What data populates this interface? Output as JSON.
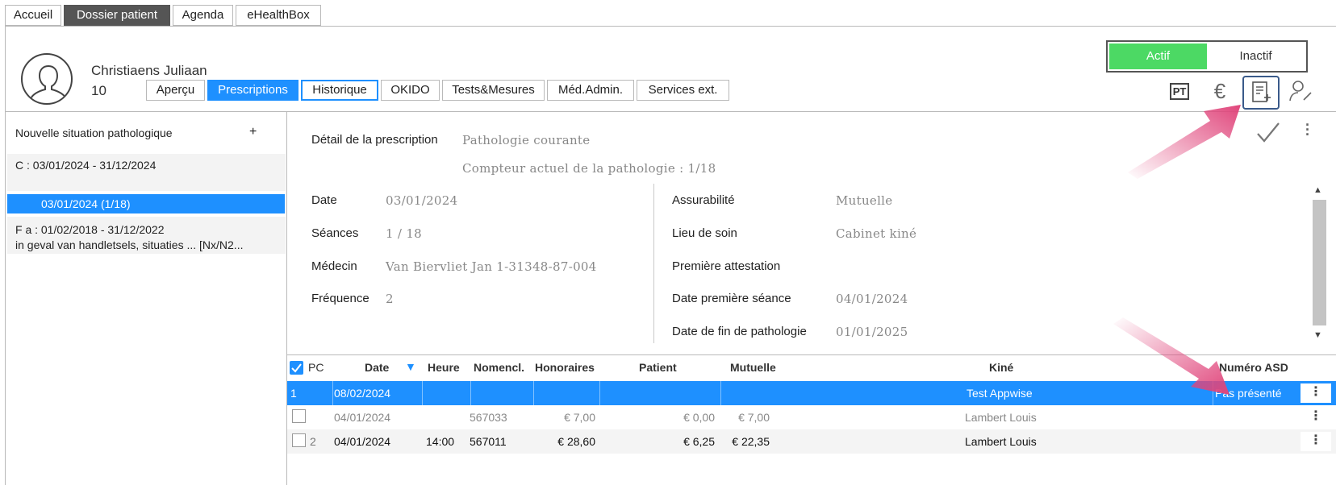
{
  "top_tabs": [
    {
      "label": "Accueil"
    },
    {
      "label": "Dossier patient"
    },
    {
      "label": "Agenda"
    },
    {
      "label": "eHealthBox"
    }
  ],
  "patient": {
    "name": "Christiaens Juliaan",
    "number": "10"
  },
  "sub_tabs": [
    {
      "label": "Aperçu"
    },
    {
      "label": "Prescriptions"
    },
    {
      "label": "Historique"
    },
    {
      "label": "OKIDO"
    },
    {
      "label": "Tests&Mesures"
    },
    {
      "label": "Méd.Admin."
    },
    {
      "label": "Services ext."
    }
  ],
  "status_toggle": {
    "active": "Actif",
    "inactive": "Inactif"
  },
  "header_icons": {
    "pt": "PT",
    "euro": "€"
  },
  "left_panel": {
    "new_situation": "Nouvelle situation pathologique",
    "add": "+",
    "situation_c": "C : 03/01/2024 - 31/12/2024",
    "selected_item": "03/01/2024  (1/18)",
    "situation_fa": "F a : 01/02/2018 - 31/12/2022",
    "situation_fa_desc": "in geval van handletsels, situaties ... [Nx/N2..."
  },
  "detail": {
    "title": "Détail de la prescription",
    "pathology": "Pathologie courante",
    "counter": "Compteur actuel de la pathologie : 1/18",
    "date_label": "Date",
    "date_value": "03/01/2024",
    "seances_label": "Séances",
    "seances_value": "1 / 18",
    "medecin_label": "Médecin",
    "medecin_value": "Van Biervliet Jan 1-31348-87-004",
    "frequence_label": "Fréquence",
    "frequence_value": "2",
    "assurabilite_label": "Assurabilité",
    "assurabilite_value": "Mutuelle",
    "lieu_label": "Lieu de soin",
    "lieu_value": "Cabinet kiné",
    "premiere_attestation_label": "Première attestation",
    "date_premiere_label": "Date première séance",
    "date_premiere_value": "04/01/2024",
    "date_fin_label": "Date de fin de pathologie",
    "date_fin_value": "01/01/2025"
  },
  "table": {
    "headers": {
      "pc": "PC",
      "date": "Date",
      "heure": "Heure",
      "nomencl": "Nomencl.",
      "honoraires": "Honoraires",
      "patient": "Patient",
      "mutuelle": "Mutuelle",
      "kine": "Kiné",
      "asd": "Numéro ASD"
    },
    "rows": [
      {
        "pc": "1",
        "date": "08/02/2024",
        "heure": "",
        "nomencl": "",
        "honoraires": "",
        "patient": "",
        "mutuelle": "",
        "kine": "Test Appwise",
        "asd": "Pas présenté"
      },
      {
        "pc": "",
        "date": "04/01/2024",
        "heure": "",
        "nomencl": "567033",
        "honoraires": "€ 7,00",
        "patient": "€ 0,00",
        "mutuelle": "€ 7,00",
        "kine": "Lambert Louis",
        "asd": ""
      },
      {
        "pc": "2",
        "date": "04/01/2024",
        "heure": "14:00",
        "nomencl": "567011",
        "honoraires": "€ 28,60",
        "patient": "€ 6,25",
        "mutuelle": "€ 22,35",
        "kine": "Lambert Louis",
        "asd": ""
      }
    ]
  },
  "colors": {
    "accent": "#1e90ff",
    "active_green": "#4cd964",
    "arrow_pink": "#e0457b"
  }
}
